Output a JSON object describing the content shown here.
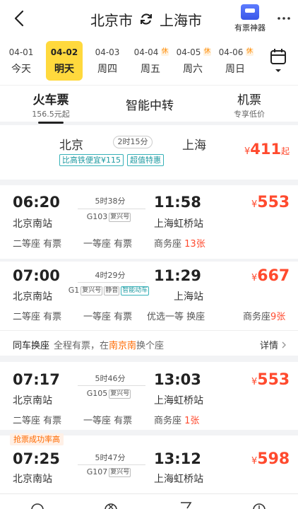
{
  "header": {
    "from_city": "北京市",
    "to_city": "上海市",
    "ticket_tool_label": "有票神器"
  },
  "dates": [
    {
      "date": "04-01",
      "weekday": "今天",
      "rest": "",
      "active": false
    },
    {
      "date": "04-02",
      "weekday": "明天",
      "rest": "",
      "active": true
    },
    {
      "date": "04-03",
      "weekday": "周四",
      "rest": "",
      "active": false
    },
    {
      "date": "04-04",
      "weekday": "周五",
      "rest": "休",
      "active": false
    },
    {
      "date": "04-05",
      "weekday": "周六",
      "rest": "休",
      "active": false
    },
    {
      "date": "04-06",
      "weekday": "周日",
      "rest": "休",
      "active": false
    }
  ],
  "modes": [
    {
      "title": "火车票",
      "sub": "156.5元起",
      "active": true
    },
    {
      "title": "智能中转",
      "sub": "",
      "active": false
    },
    {
      "title": "机票",
      "sub": "专享低价",
      "active": false
    }
  ],
  "flight": {
    "from": "北京",
    "to": "上海",
    "duration": "2时15分",
    "tag1": "比高铁便宜¥115",
    "tag2": "超值特惠",
    "currency": "¥",
    "price": "411",
    "suffix": "起"
  },
  "trains": [
    {
      "depart_time": "06:20",
      "depart_station": "北京南站",
      "arrive_time": "11:58",
      "arrive_station": "上海虹桥站",
      "duration": "5时38分",
      "train_no": "G103",
      "badges": [
        "复兴号"
      ],
      "currency": "¥",
      "price": "553",
      "seats": [
        {
          "name": "二等座",
          "status": "有票",
          "count": ""
        },
        {
          "name": "一等座",
          "status": "有票",
          "count": ""
        },
        {
          "name": "商务座",
          "status": "",
          "count": "13张"
        }
      ]
    },
    {
      "depart_time": "07:00",
      "depart_station": "北京南站",
      "arrive_time": "11:29",
      "arrive_station": "上海站",
      "duration": "4时29分",
      "train_no": "G1",
      "badges": [
        "复兴号",
        "静音",
        "智能动车"
      ],
      "currency": "¥",
      "price": "667",
      "seats": [
        {
          "name": "二等座",
          "status": "有票",
          "count": ""
        },
        {
          "name": "一等座",
          "status": "有票",
          "count": ""
        },
        {
          "name": "优选一等",
          "status": "换座",
          "count": ""
        },
        {
          "name": "商务座",
          "status": "",
          "count": "9张"
        }
      ],
      "transfer": {
        "label": "同车换座",
        "prefix": "全程有票，在",
        "station": "南京南",
        "suffix": "换个座",
        "details": "详情"
      }
    },
    {
      "depart_time": "07:17",
      "depart_station": "北京南站",
      "arrive_time": "13:03",
      "arrive_station": "上海虹桥站",
      "duration": "5时46分",
      "train_no": "G105",
      "badges": [
        "复兴号"
      ],
      "currency": "¥",
      "price": "553",
      "seats": [
        {
          "name": "二等座",
          "status": "有票",
          "count": ""
        },
        {
          "name": "一等座",
          "status": "有票",
          "count": ""
        },
        {
          "name": "商务座",
          "status": "",
          "count": "1张"
        }
      ]
    },
    {
      "badge_top": "抢票成功率高",
      "depart_time": "07:25",
      "depart_station": "北京南站",
      "arrive_time": "13:12",
      "arrive_station": "上海虹桥站",
      "duration": "5时47分",
      "train_no": "G107",
      "badges": [
        "复兴号"
      ],
      "currency": "¥",
      "price": "598"
    }
  ]
}
